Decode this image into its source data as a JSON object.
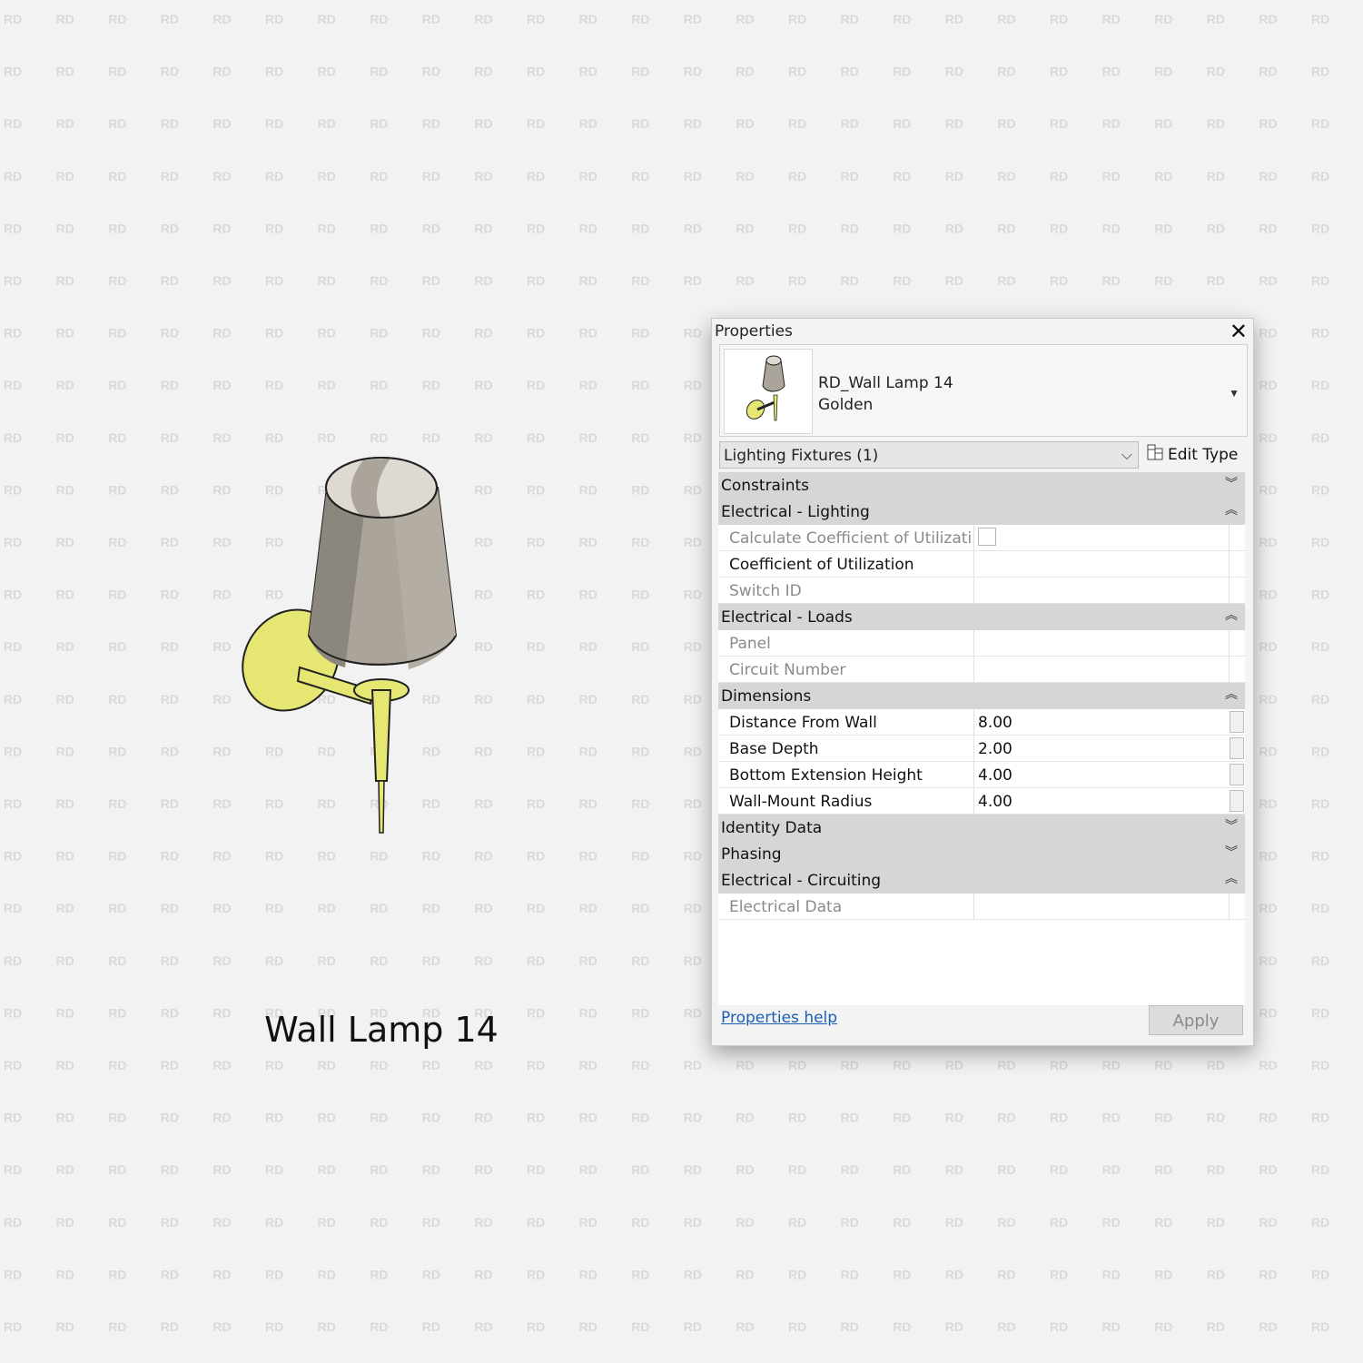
{
  "watermark": "RD",
  "caption": "Wall Lamp 14",
  "panel": {
    "title": "Properties",
    "type_family": "RD_Wall Lamp 14",
    "type_name": "Golden",
    "filter_value": "Lighting Fixtures (1)",
    "edit_type_label": "Edit Type",
    "help_label": "Properties help",
    "apply_label": "Apply"
  },
  "groups": {
    "constraints": "Constraints",
    "electrical_lighting": "Electrical - Lighting",
    "electrical_loads": "Electrical - Loads",
    "dimensions": "Dimensions",
    "identity_data": "Identity Data",
    "phasing": "Phasing",
    "electrical_circuiting": "Electrical - Circuiting"
  },
  "rows": {
    "calc_cu": "Calculate Coefficient of Utilizati...",
    "cu": "Coefficient of Utilization",
    "switch_id": "Switch ID",
    "panel": "Panel",
    "circuit_number": "Circuit Number",
    "distance_from_wall": "Distance From Wall",
    "distance_from_wall_value": "8.00",
    "base_depth": "Base Depth",
    "base_depth_value": "2.00",
    "bottom_ext_height": "Bottom Extension Height",
    "bottom_ext_height_value": "4.00",
    "wall_mount_radius": "Wall-Mount Radius",
    "wall_mount_radius_value": "4.00",
    "electrical_data": "Electrical Data"
  },
  "icons": {
    "close": "close-icon",
    "dropdown": "chevron-down-icon",
    "edit_type": "edit-type-icon",
    "collapse": "collapse-icon",
    "expand": "expand-icon"
  },
  "colors": {
    "shade": "#aaa49a",
    "brass": "#e6e673",
    "link": "#1a5fb4"
  }
}
